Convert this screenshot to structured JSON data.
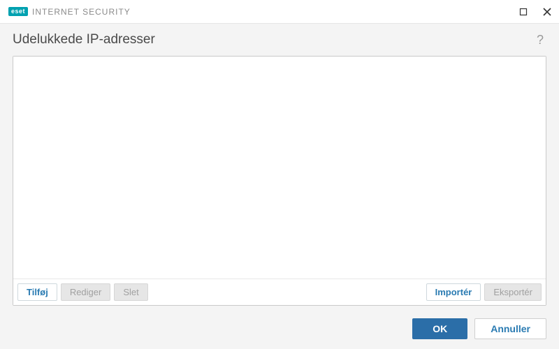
{
  "titlebar": {
    "brand_logo_text": "eset",
    "brand_product": "INTERNET SECURITY"
  },
  "header": {
    "title": "Udelukkede IP-adresser",
    "help_symbol": "?"
  },
  "toolbar": {
    "add_label": "Tilføj",
    "edit_label": "Rediger",
    "delete_label": "Slet",
    "import_label": "Importér",
    "export_label": "Eksportér"
  },
  "footer": {
    "ok_label": "OK",
    "cancel_label": "Annuller"
  },
  "list": {
    "items": []
  }
}
